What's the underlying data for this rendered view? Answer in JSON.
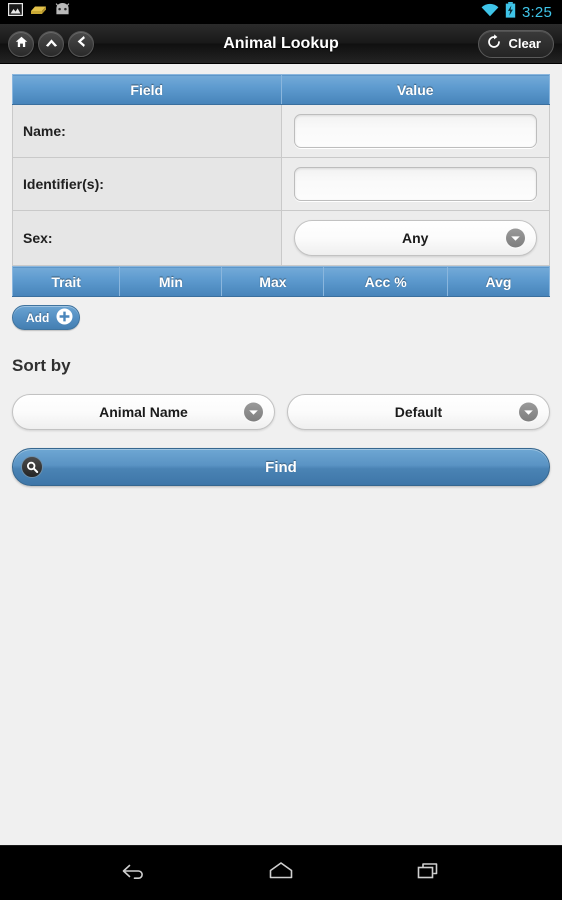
{
  "status_bar": {
    "notification_icons": [
      "image-icon",
      "sponge-icon",
      "android-head-icon"
    ],
    "wifi_icon": "wifi-icon",
    "battery_icon": "battery-charging-icon",
    "time": "3:25",
    "accent_color": "#3fc4e8"
  },
  "action_bar": {
    "title": "Animal Lookup",
    "nav_buttons": [
      {
        "name": "home-icon"
      },
      {
        "name": "up-icon"
      },
      {
        "name": "back-icon"
      }
    ],
    "clear_label": "Clear",
    "clear_icon": "refresh-icon"
  },
  "field_table": {
    "headers": [
      "Field",
      "Value"
    ],
    "header_color": "#5e9bcf",
    "rows": [
      {
        "label": "Name:",
        "type": "text",
        "value": "",
        "placeholder": ""
      },
      {
        "label": "Identifier(s):",
        "type": "text",
        "value": "",
        "placeholder": ""
      },
      {
        "label": "Sex:",
        "type": "select",
        "value": "Any"
      }
    ]
  },
  "trait_table": {
    "headers": [
      "Trait",
      "Min",
      "Max",
      "Acc %",
      "Avg"
    ],
    "rows": []
  },
  "add_button": {
    "label": "Add",
    "icon": "plus-circle-icon"
  },
  "sort": {
    "title": "Sort by",
    "primary": {
      "value": "Animal Name"
    },
    "secondary": {
      "value": "Default"
    }
  },
  "find_button": {
    "label": "Find",
    "icon": "search-icon"
  },
  "system_nav": {
    "back": "back-arrow-icon",
    "home": "home-pentagon-icon",
    "recents": "recent-apps-icon"
  }
}
